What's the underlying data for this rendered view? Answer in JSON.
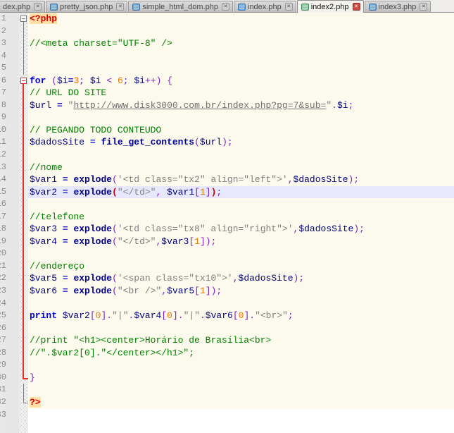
{
  "tab_bar": {
    "tabs": [
      {
        "label": "dex.php",
        "active": false,
        "icon": false
      },
      {
        "label": "pretty_json.php",
        "active": false,
        "icon": true
      },
      {
        "label": "simple_html_dom.php",
        "active": false,
        "icon": true
      },
      {
        "label": "index.php",
        "active": false,
        "icon": true
      },
      {
        "label": "index2.php",
        "active": true,
        "icon": true
      },
      {
        "label": "index3.php",
        "active": false,
        "icon": true
      }
    ],
    "close_icon_glyph": "✕"
  },
  "colors": {
    "php_zone_bg": "#fcfaec",
    "html_zone_bg": "#ffffff",
    "current_line_bg": "#e8e8fc",
    "comment": "#008200",
    "keyword": "#0000e8",
    "function": "#000090",
    "variable": "#000080",
    "string": "#808080",
    "number": "#ee7500",
    "operator": "#8020c0",
    "php_tag": "#e00000",
    "php_tag_bg": "#ffdfa8",
    "matched_paren": "#c40000",
    "fold_active": "#e23024",
    "fold_inactive": "#808080"
  },
  "editor": {
    "language": "PHP",
    "lines": [
      {
        "num": 1,
        "zone": "php",
        "fold": "open-gray",
        "tokens": [
          [
            "p",
            "<?php"
          ]
        ]
      },
      {
        "num": 2,
        "zone": "php",
        "fold": "line-gray",
        "tokens": []
      },
      {
        "num": 3,
        "zone": "php",
        "fold": "line-gray",
        "tokens": [
          [
            "c",
            "//<meta charset=\"UTF-8\" />"
          ]
        ]
      },
      {
        "num": 4,
        "zone": "php",
        "fold": "line-gray",
        "tokens": []
      },
      {
        "num": 5,
        "zone": "php",
        "fold": "line-gray",
        "tokens": []
      },
      {
        "num": 6,
        "zone": "php",
        "fold": "open-red",
        "tokens": [
          [
            "k",
            "for"
          ],
          [
            "t",
            " "
          ],
          [
            "o",
            "("
          ],
          [
            "v",
            "$i"
          ],
          [
            "e",
            "="
          ],
          [
            "n",
            "3"
          ],
          [
            "o",
            ";"
          ],
          [
            "t",
            " "
          ],
          [
            "v",
            "$i"
          ],
          [
            "t",
            " "
          ],
          [
            "o",
            "<"
          ],
          [
            "t",
            " "
          ],
          [
            "n",
            "6"
          ],
          [
            "o",
            ";"
          ],
          [
            "t",
            " "
          ],
          [
            "v",
            "$i"
          ],
          [
            "o",
            "++"
          ],
          [
            "o",
            ")"
          ],
          [
            "t",
            " "
          ],
          [
            "o",
            "{"
          ]
        ]
      },
      {
        "num": 7,
        "zone": "php",
        "fold": "line-red",
        "tokens": [
          [
            "c",
            "// URL DO SITE"
          ]
        ]
      },
      {
        "num": 8,
        "zone": "php",
        "fold": "line-red",
        "tokens": [
          [
            "v",
            "$url"
          ],
          [
            "t",
            " "
          ],
          [
            "e",
            "="
          ],
          [
            "t",
            " "
          ],
          [
            "s",
            "\""
          ],
          [
            "u",
            "http://www.disk3000.com.br/index.php?pg=7&sub="
          ],
          [
            "s",
            "\""
          ],
          [
            "o",
            "."
          ],
          [
            "v",
            "$i"
          ],
          [
            "o",
            ";"
          ]
        ]
      },
      {
        "num": 9,
        "zone": "php",
        "fold": "line-red",
        "tokens": []
      },
      {
        "num": 10,
        "zone": "php",
        "fold": "line-red",
        "tokens": [
          [
            "c",
            "// PEGANDO TODO CONTEUDO"
          ]
        ]
      },
      {
        "num": 11,
        "zone": "php",
        "fold": "line-red",
        "tokens": [
          [
            "v",
            "$dadosSite"
          ],
          [
            "t",
            " "
          ],
          [
            "e",
            "="
          ],
          [
            "t",
            " "
          ],
          [
            "f",
            "file_get_contents"
          ],
          [
            "o",
            "("
          ],
          [
            "v",
            "$url"
          ],
          [
            "o",
            ");"
          ]
        ]
      },
      {
        "num": 12,
        "zone": "php",
        "fold": "line-red",
        "tokens": []
      },
      {
        "num": 13,
        "zone": "php",
        "fold": "line-red",
        "tokens": [
          [
            "c",
            "//nome"
          ]
        ]
      },
      {
        "num": 14,
        "zone": "php",
        "fold": "line-red",
        "tokens": [
          [
            "v",
            "$var1"
          ],
          [
            "t",
            " "
          ],
          [
            "e",
            "="
          ],
          [
            "t",
            " "
          ],
          [
            "f",
            "explode"
          ],
          [
            "o",
            "("
          ],
          [
            "s",
            "'<td class=\"tx2\" align=\"left\">'"
          ],
          [
            "o",
            ","
          ],
          [
            "v",
            "$dadosSite"
          ],
          [
            "o",
            ");"
          ]
        ]
      },
      {
        "num": 15,
        "zone": "php",
        "fold": "line-red",
        "highlight": true,
        "tokens": [
          [
            "v",
            "$var2"
          ],
          [
            "t",
            " "
          ],
          [
            "e",
            "="
          ],
          [
            "t",
            " "
          ],
          [
            "f",
            "explode"
          ],
          [
            "m",
            "("
          ],
          [
            "s",
            "\"</td>\""
          ],
          [
            "o",
            ","
          ],
          [
            "t",
            " "
          ],
          [
            "v",
            "$var1"
          ],
          [
            "o",
            "["
          ],
          [
            "n",
            "1"
          ],
          [
            "o",
            "]"
          ],
          [
            "m",
            ")"
          ],
          [
            "o",
            ";"
          ]
        ]
      },
      {
        "num": 16,
        "zone": "php",
        "fold": "line-red",
        "tokens": []
      },
      {
        "num": 17,
        "zone": "php",
        "fold": "line-red",
        "tokens": [
          [
            "c",
            "//telefone"
          ]
        ]
      },
      {
        "num": 18,
        "zone": "php",
        "fold": "line-red",
        "tokens": [
          [
            "v",
            "$var3"
          ],
          [
            "t",
            " "
          ],
          [
            "e",
            "="
          ],
          [
            "t",
            " "
          ],
          [
            "f",
            "explode"
          ],
          [
            "o",
            "("
          ],
          [
            "s",
            "'<td class=\"tx8\" align=\"right\">'"
          ],
          [
            "o",
            ","
          ],
          [
            "v",
            "$dadosSite"
          ],
          [
            "o",
            ");"
          ]
        ]
      },
      {
        "num": 19,
        "zone": "php",
        "fold": "line-red",
        "tokens": [
          [
            "v",
            "$var4"
          ],
          [
            "t",
            " "
          ],
          [
            "e",
            "="
          ],
          [
            "t",
            " "
          ],
          [
            "f",
            "explode"
          ],
          [
            "o",
            "("
          ],
          [
            "s",
            "\"</td>\""
          ],
          [
            "o",
            ","
          ],
          [
            "v",
            "$var3"
          ],
          [
            "o",
            "["
          ],
          [
            "n",
            "1"
          ],
          [
            "o",
            "]"
          ],
          [
            "o",
            ");"
          ]
        ]
      },
      {
        "num": 20,
        "zone": "php",
        "fold": "line-red",
        "tokens": []
      },
      {
        "num": 21,
        "zone": "php",
        "fold": "line-red",
        "tokens": [
          [
            "c",
            "//endereço"
          ]
        ]
      },
      {
        "num": 22,
        "zone": "php",
        "fold": "line-red",
        "tokens": [
          [
            "v",
            "$var5"
          ],
          [
            "t",
            " "
          ],
          [
            "e",
            "="
          ],
          [
            "t",
            " "
          ],
          [
            "f",
            "explode"
          ],
          [
            "o",
            "("
          ],
          [
            "s",
            "'<span class=\"tx10\">'"
          ],
          [
            "o",
            ","
          ],
          [
            "v",
            "$dadosSite"
          ],
          [
            "o",
            ");"
          ]
        ]
      },
      {
        "num": 23,
        "zone": "php",
        "fold": "line-red",
        "tokens": [
          [
            "v",
            "$var6"
          ],
          [
            "t",
            " "
          ],
          [
            "e",
            "="
          ],
          [
            "t",
            " "
          ],
          [
            "f",
            "explode"
          ],
          [
            "o",
            "("
          ],
          [
            "s",
            "\"<br />\""
          ],
          [
            "o",
            ","
          ],
          [
            "v",
            "$var5"
          ],
          [
            "o",
            "["
          ],
          [
            "n",
            "1"
          ],
          [
            "o",
            "]"
          ],
          [
            "o",
            ");"
          ]
        ]
      },
      {
        "num": 24,
        "zone": "php",
        "fold": "line-red",
        "tokens": []
      },
      {
        "num": 25,
        "zone": "php",
        "fold": "line-red",
        "tokens": [
          [
            "k",
            "print"
          ],
          [
            "t",
            " "
          ],
          [
            "v",
            "$var2"
          ],
          [
            "o",
            "["
          ],
          [
            "n",
            "0"
          ],
          [
            "o",
            "]"
          ],
          [
            "o",
            "."
          ],
          [
            "s",
            "\"|\""
          ],
          [
            "o",
            "."
          ],
          [
            "v",
            "$var4"
          ],
          [
            "o",
            "["
          ],
          [
            "n",
            "0"
          ],
          [
            "o",
            "]"
          ],
          [
            "o",
            "."
          ],
          [
            "s",
            "\"|\""
          ],
          [
            "o",
            "."
          ],
          [
            "v",
            "$var6"
          ],
          [
            "o",
            "["
          ],
          [
            "n",
            "0"
          ],
          [
            "o",
            "]"
          ],
          [
            "o",
            "."
          ],
          [
            "s",
            "\"<br>\""
          ],
          [
            "o",
            ";"
          ]
        ]
      },
      {
        "num": 26,
        "zone": "php",
        "fold": "line-red",
        "tokens": []
      },
      {
        "num": 27,
        "zone": "php",
        "fold": "line-red",
        "tokens": [
          [
            "c",
            "//print \"<h1><center>Horário de Brasília<br>"
          ]
        ]
      },
      {
        "num": 28,
        "zone": "php",
        "fold": "line-red",
        "tokens": [
          [
            "c",
            "//\".$var2[0].\"</center></h1>\";"
          ]
        ]
      },
      {
        "num": 29,
        "zone": "php",
        "fold": "line-red",
        "tokens": []
      },
      {
        "num": 30,
        "zone": "php",
        "fold": "end-red",
        "tokens": [
          [
            "o",
            "}"
          ]
        ]
      },
      {
        "num": 31,
        "zone": "php",
        "fold": "line-gray",
        "tokens": []
      },
      {
        "num": 32,
        "zone": "php",
        "fold": "end-gray",
        "tokens": [
          [
            "p",
            "?>"
          ]
        ]
      },
      {
        "num": 33,
        "zone": "html",
        "fold": null,
        "tokens": []
      }
    ]
  }
}
